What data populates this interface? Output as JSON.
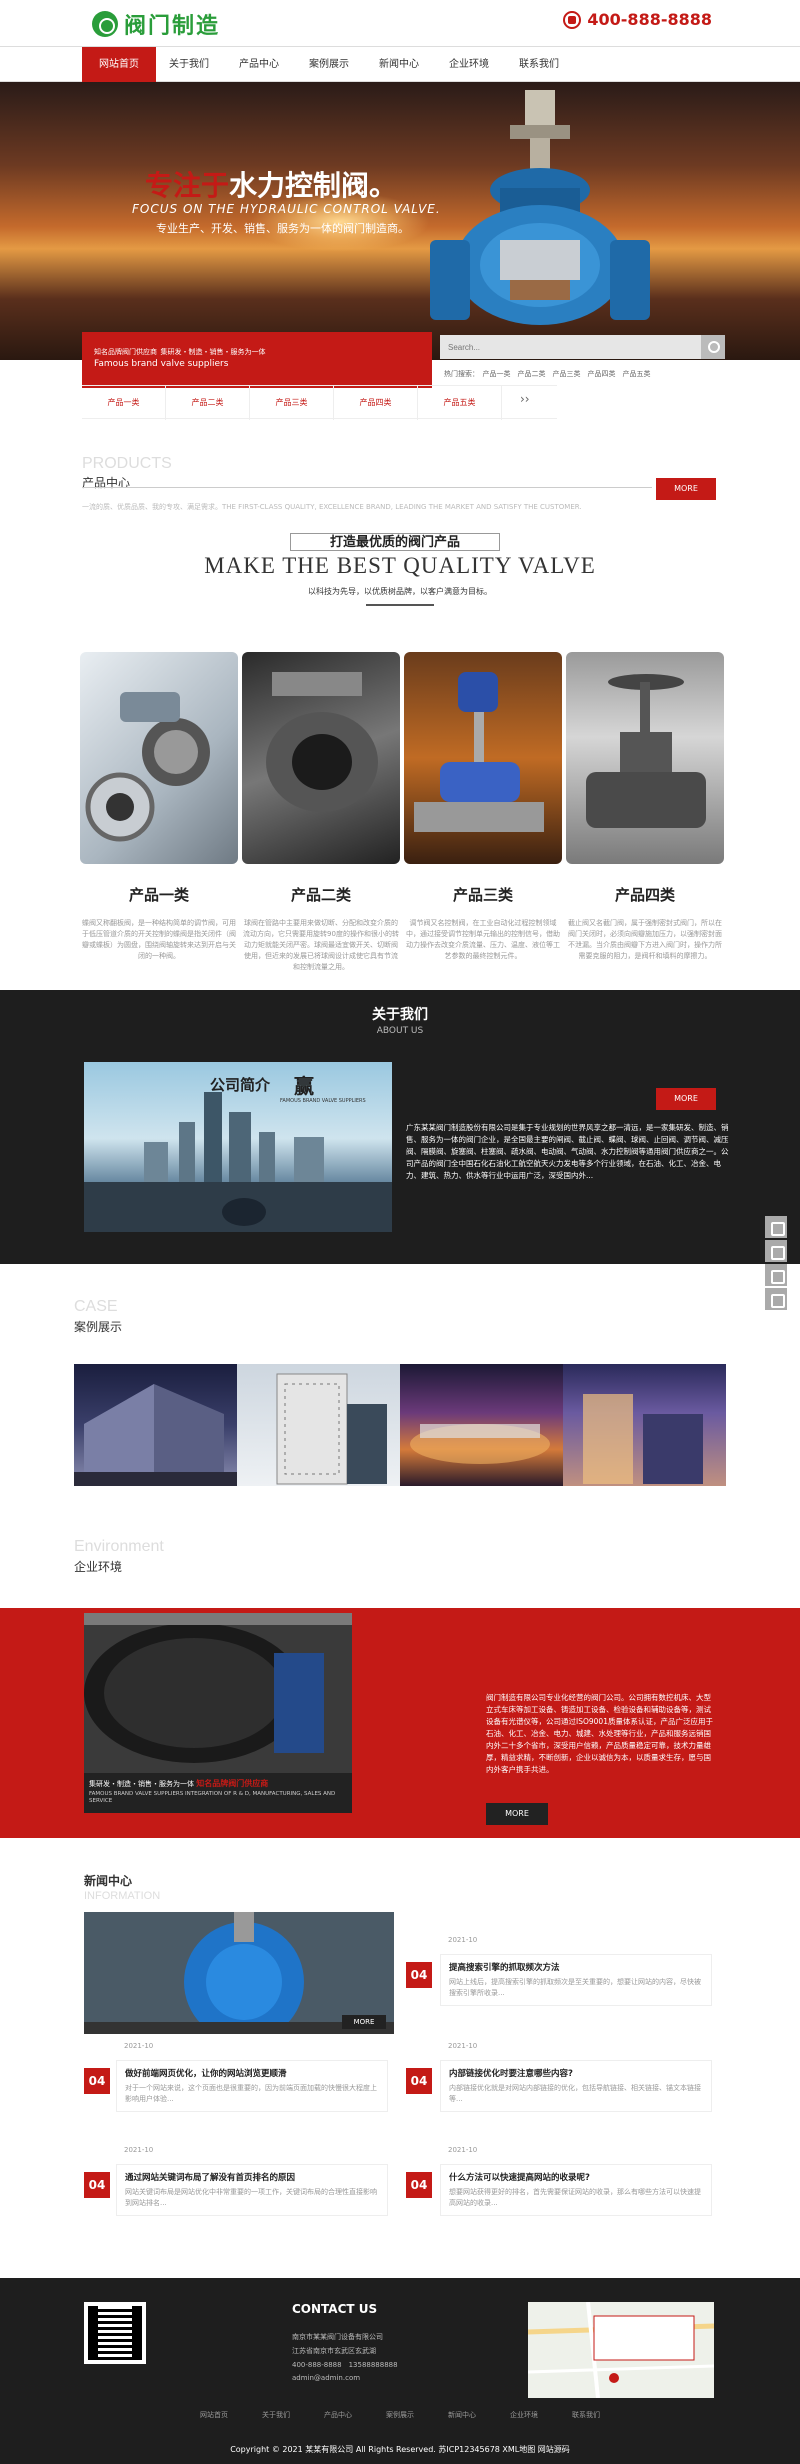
{
  "header": {
    "logo_text": "阀门制造",
    "phone": "400-888-8888"
  },
  "nav": [
    "网站首页",
    "关于我们",
    "产品中心",
    "案例展示",
    "新闻中心",
    "企业环境",
    "联系我们"
  ],
  "banner": {
    "title_a": "专注于",
    "title_b": "水力控制阀。",
    "en": "FOCUS ON THE HYDRAULIC CONTROL VALVE.",
    "sub": "专业生产、开发、销售、服务为一体的阀门制造商。"
  },
  "brand": {
    "line1": "知名品牌阀门供应商",
    "line1_small": "集研发・制造・销售・服务为一体",
    "line2": "Famous brand valve suppliers"
  },
  "search": {
    "placeholder": "Search..."
  },
  "hot": "热门搜索：　产品一类　产品二类　产品三类　产品四类　产品五类",
  "categories": [
    "产品一类",
    "产品二类",
    "产品三类",
    "产品四类",
    "产品五类"
  ],
  "cat_more": "››",
  "products": {
    "en": "PRODUCTS",
    "cn": "产品中心",
    "more": "MORE",
    "desc": "一流的质、优质品质、我的专攻、满足需求。THE FIRST-CLASS QUALITY, EXCELLENCE BRAND, LEADING THE MARKET AND SATISFY THE CUSTOMER.",
    "make_cn": "打造最优质的阀门产品",
    "make_en": "MAKE THE BEST QUALITY VALVE",
    "make_sub": "以科技为先导，以优质树品牌，以客户满意为目标。",
    "items": [
      {
        "title": "产品一类",
        "desc": "蝶阀又称翻板阀，是一种结构简单的调节阀，可用于低压管道介质的开关控制的蝶阀是指关闭件（阀瓣或蝶板）为圆盘，围绕阀轴旋转来达到开启与关闭的一种阀。"
      },
      {
        "title": "产品二类",
        "desc": "球阀在管路中主要用来做切断、分配和改变介质的流动方向，它只需要用旋转90度的操作和很小的转动力矩就能关闭严密。球阀最适宜做开关、切断阀使用，但近来的发展已将球阀设计成使它具有节流和控制流量之用。"
      },
      {
        "title": "产品三类",
        "desc": "调节阀又名控制阀，在工业自动化过程控制领域中，通过接受调节控制单元输出的控制信号，借助动力操作去改变介质流量、压力、温度、液位等工艺参数的最终控制元件。"
      },
      {
        "title": "产品四类",
        "desc": "截止阀又名截门阀，属于强制密封式阀门，所以在阀门关闭时，必须向阀瓣施加压力，以强制密封面不泄漏。当介质由阀瓣下方进入阀门时，操作力所需要克服的阻力，是阀杆和填料的摩擦力。"
      }
    ]
  },
  "about": {
    "cn": "关于我们",
    "en": "ABOUT US",
    "more": "MORE",
    "img_title": "公司简介",
    "img_brand": "赢",
    "img_brand_small": "FAMOUS BRAND VALVE SUPPLIERS",
    "text": "广东某某阀门制造股份有限公司是集于专业规划的世界风享之都一清远，是一家集研发、制造、销售、服务为一体的阀门企业，是全国最主要的闸阀、截止阀、蝶阀、球阀、止回阀、调节阀、减压阀、隔膜阀、旋塞阀、柱塞阀、疏水阀、电动阀、气动阀、水力控制阀等通用阀门供应商之一。公司产品的阀门全中国石化石油化工航空航天火力发电等多个行业领域，在石油、化工、冶金、电力、建筑、热力、供水等行业中运用广泛，深受国内外..."
  },
  "case": {
    "en": "CASE",
    "cn": "案例展示"
  },
  "env": {
    "en": "Environment",
    "cn": "企业环境",
    "cap_small": "集研发・制造・销售・服务为一体",
    "cap_brand": "知名品牌阀门供应商",
    "cap_en": "FAMOUS BRAND VALVE SUPPLIERS INTEGRATION OF R & D, MANUFACTURING, SALES AND SERVICE",
    "text": "阀门制造有限公司专业化经营的阀门公司。公司拥有数控机床、大型立式车床等加工设备、铸造加工设备、检验设备和辅助设备等，测试设备有光谱仪等，公司通过ISO9001质量体系认证，产品广泛应用于石油、化工、冶金、电力、城建、水处理等行业，产品和服务远销国内外二十多个省市，深受用户信赖，产品质量稳定可靠，技术力量雄厚，精益求精，不断创新，企业以诚信为本，以质量求生存，愿与国内外客户携手共进。",
    "more": "MORE"
  },
  "news": {
    "cn": "新闻中心",
    "en": "INFORMATION",
    "img_more": "MORE",
    "items": [
      {
        "date": "2021-10",
        "day": "04",
        "title": "提高搜索引擎的抓取频次方法",
        "desc": "网站上线后，提高搜索引擎的抓取频次是至关重要的，想要让网站的内容，尽快被搜索引擎所收录..."
      },
      {
        "date": "2021-10",
        "day": "04",
        "title": "做好前端网页优化，让你的网站浏览更顺滑",
        "desc": "对于一个网站来说，这个页面也是很重要的，因为前端页面加载的快慢很大程度上影响用户体验..."
      },
      {
        "date": "2021-10",
        "day": "04",
        "title": "内部链接优化时要注意哪些内容?",
        "desc": "内部链接优化就是对网站内部链接的优化，包括导航链接、相关链接、锚文本链接等..."
      },
      {
        "date": "2021-10",
        "day": "04",
        "title": "通过网站关键词布局了解没有首页排名的原因",
        "desc": "网站关键词布局是网站优化中非常重要的一项工作，关键词布局的合理性直接影响到网站排名..."
      },
      {
        "date": "2021-10",
        "day": "04",
        "title": "什么方法可以快速提高网站的收录呢?",
        "desc": "想要网站获得更好的排名，首先需要保证网站的收录，那么有哪些方法可以快速提高网站的收录..."
      }
    ]
  },
  "footer": {
    "contact_title": "CONTACT US",
    "lines": [
      "南京市某某阀门设备有限公司",
      "江苏省南京市玄武区玄武湖",
      "400-888-8888　13588888888",
      "admin@admin.com"
    ],
    "links": [
      "网站首页",
      "关于我们",
      "产品中心",
      "案例展示",
      "新闻中心",
      "企业环境",
      "联系我们"
    ],
    "copyright": "Copyright © 2021 某某有限公司 All Rights Reserved.  苏ICP12345678  XML地图  网站源码"
  }
}
